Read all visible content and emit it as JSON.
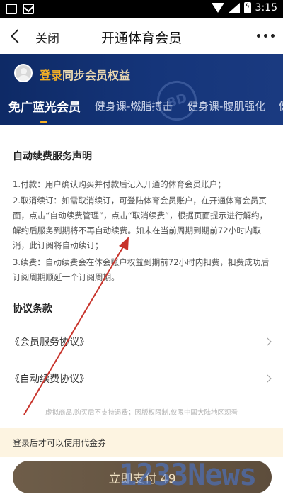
{
  "status_bar": {
    "time": "3:15",
    "icons": [
      "photo-icon",
      "mail-icon",
      "wifi-icon",
      "signal-icon",
      "battery-charging-icon"
    ]
  },
  "nav": {
    "back_icon": "chevron-left-icon",
    "close_label": "关闭",
    "title": "开通体育会员",
    "more_icon": "more-dots-icon"
  },
  "vip_header": {
    "login_word": "登录",
    "login_rest": "同步会员权益",
    "watermark": "BD",
    "tabs": [
      {
        "label": "免广蓝光会员",
        "active": true
      },
      {
        "label": "健身课-燃脂搏击",
        "active": false
      },
      {
        "label": "健身课-腹肌强化",
        "active": false
      },
      {
        "label": "健",
        "active": false
      }
    ]
  },
  "content": {
    "section1_title": "自动续费服务声明",
    "paragraphs": [
      "1.付款：用户确认购买并付款后记入开通的体育会员账户；",
      "2.取消续订：如需取消续订，可登陆体育会员账户，在开通体育会员页面，点击“自动续费管理”，点击“取消续费”，根据页面提示进行解约，解约后服务到期将不再自动续费。如未在当前周期到期前72小时内取消，此订阅将自动续订；",
      "3.续费：自动续费会在体会账户权益到期前72小时内扣费，扣费成功后订阅周期顺延一个订阅周期。"
    ],
    "section2_title": "协议条款",
    "links": [
      "《会员服务协议》",
      "《自动续费协议》"
    ],
    "small_notice": "虚拟商品,购买后不支持退费；因版权限制,仅限中国大陆地区观看"
  },
  "coupon": {
    "text": "登录后才可以使用代金券"
  },
  "pay": {
    "label": "立即支付 49"
  },
  "overlay": {
    "brand_watermark": "1233News",
    "arrow_color": "#c8332b"
  },
  "colors": {
    "header_bg": "#15357a",
    "accent_gold": "#f5b025",
    "pay_button": "#6e5d49",
    "coupon_bg": "#fdf4e1"
  }
}
